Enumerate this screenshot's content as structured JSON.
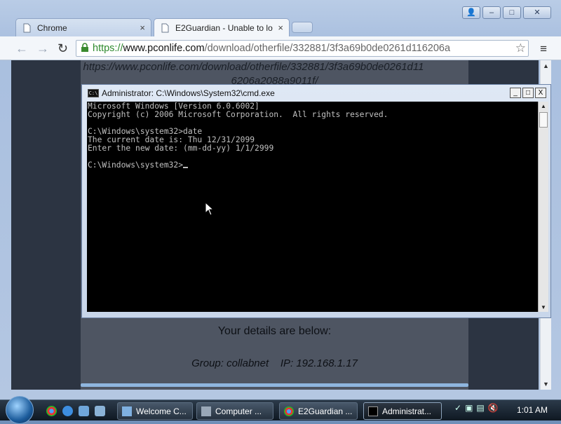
{
  "browser": {
    "tabs": [
      {
        "title": "Chrome",
        "close": "×"
      },
      {
        "title": "E2Guardian - Unable to lo",
        "close": "×"
      }
    ],
    "nav": {
      "back": "←",
      "forward": "→",
      "reload": "↻"
    },
    "address": {
      "scheme": "https://",
      "host": "www.pconlife.com",
      "path": "/download/otherfile/332881/3f3a69b0de0261d116206a"
    },
    "menu_icon": "≡",
    "window_controls": {
      "user": "👤",
      "minimize": "–",
      "maximize": "□",
      "close": "✕"
    }
  },
  "page": {
    "url_fragment_line1": "https://www.pconlife.com/download/otherfile/332881/3f3a69b0de0261d11",
    "url_fragment_line2": "6206a2088a9011f/",
    "details_title": "Your details are below:",
    "details_info": "Group: collabnet    IP: 192.168.1.17"
  },
  "cmd": {
    "title": "Administrator: C:\\Windows\\System32\\cmd.exe",
    "controls": {
      "minimize": "_",
      "maximize": "□",
      "close": "X"
    },
    "lines": [
      "Microsoft Windows [Version 6.0.6002]",
      "Copyright (c) 2006 Microsoft Corporation.  All rights reserved.",
      "",
      "C:\\Windows\\system32>date",
      "The current date is: Thu 12/31/2099",
      "Enter the new date: (mm-dd-yy) 1/1/2999",
      "",
      "C:\\Windows\\system32>"
    ]
  },
  "taskbar": {
    "tasks": [
      {
        "label": "Welcome C..."
      },
      {
        "label": "Computer ..."
      },
      {
        "label": "E2Guardian ..."
      },
      {
        "label": "Administrat..."
      }
    ],
    "clock": "1:01 AM"
  },
  "colors": {
    "console_bg": "#000000",
    "console_fg": "#c0c0c0",
    "panel_bg": "#4e5562"
  }
}
